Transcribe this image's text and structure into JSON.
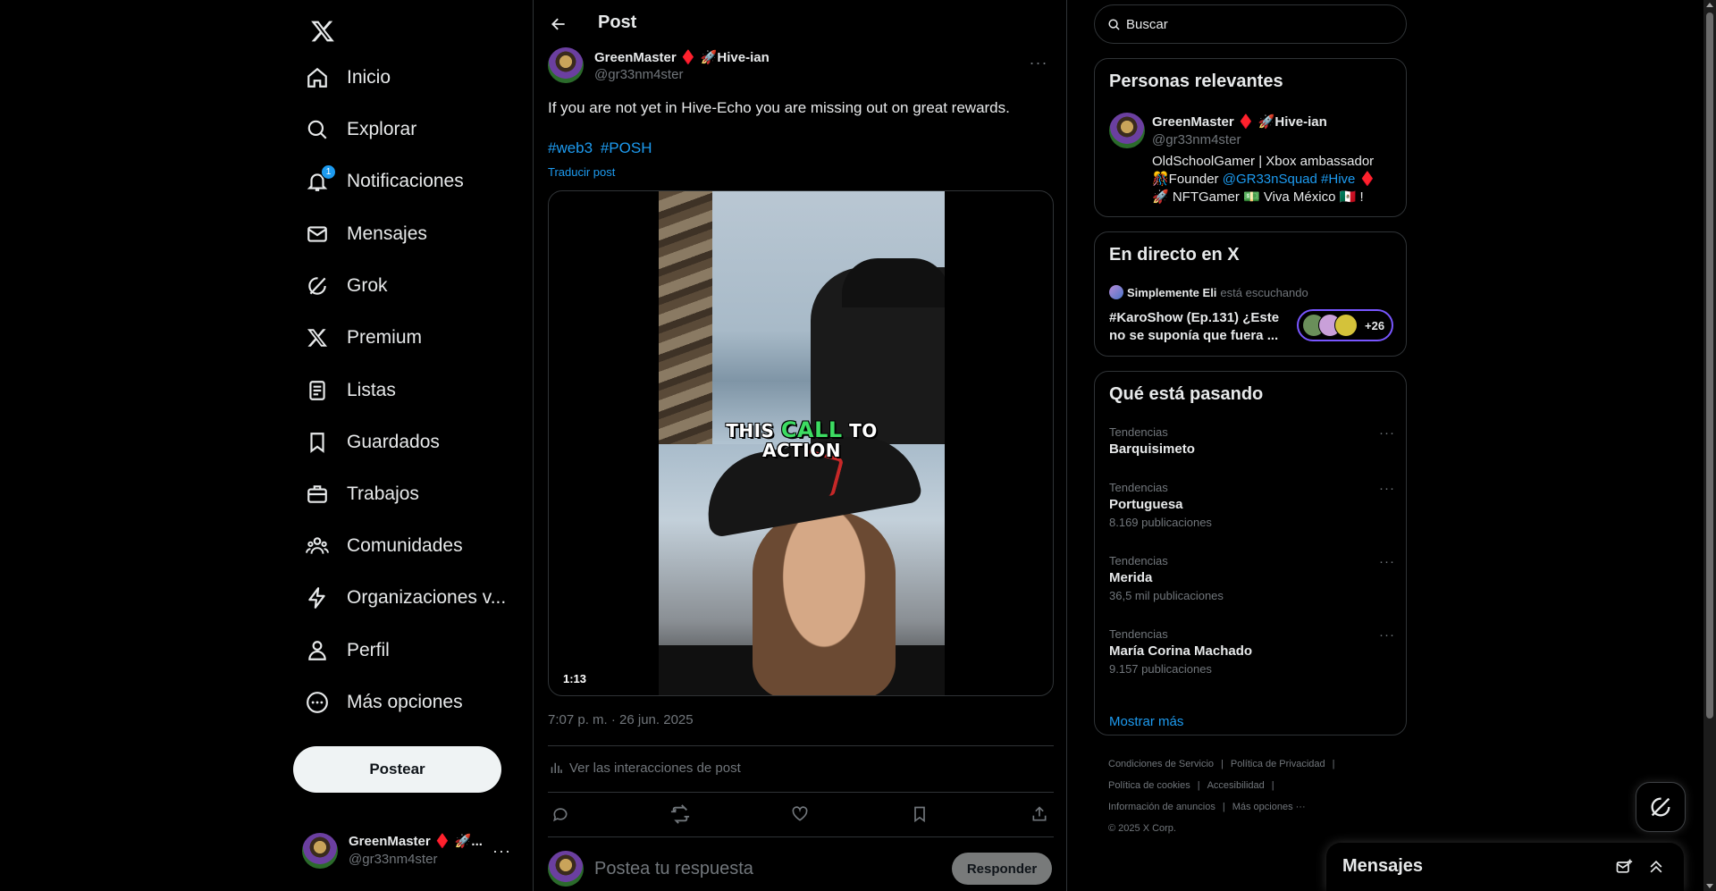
{
  "nav": {
    "items": [
      {
        "label": "Inicio",
        "icon": "home-icon"
      },
      {
        "label": "Explorar",
        "icon": "search-icon"
      },
      {
        "label": "Notificaciones",
        "icon": "bell-icon",
        "badge": "1"
      },
      {
        "label": "Mensajes",
        "icon": "mail-icon"
      },
      {
        "label": "Grok",
        "icon": "grok-icon"
      },
      {
        "label": "Premium",
        "icon": "x-logo-icon"
      },
      {
        "label": "Listas",
        "icon": "list-icon"
      },
      {
        "label": "Guardados",
        "icon": "bookmark-icon"
      },
      {
        "label": "Trabajos",
        "icon": "briefcase-icon"
      },
      {
        "label": "Comunidades",
        "icon": "people-icon"
      },
      {
        "label": "Organizaciones v...",
        "icon": "lightning-icon"
      },
      {
        "label": "Perfil",
        "icon": "person-icon"
      },
      {
        "label": "Más opciones",
        "icon": "more-circle-icon"
      }
    ],
    "post_button": "Postear",
    "account": {
      "name": "GreenMaster ♦️ 🚀...",
      "handle": "@gr33nm4ster",
      "more": "···"
    }
  },
  "header": {
    "title": "Post"
  },
  "post": {
    "author_name": "GreenMaster ♦️ 🚀Hive-ian",
    "author_handle": "@gr33nm4ster",
    "text": "If you are not yet in Hive-Echo you are missing out on great rewards.",
    "hashtags": [
      "#web3",
      "#POSH"
    ],
    "translate": "Traducir post",
    "video": {
      "caption_word1": "THIS",
      "caption_highlight": "CALL",
      "caption_word2": "TO",
      "caption_line2": "ACTION",
      "duration": "1:13"
    },
    "timestamp": "7:07 p. m. · 26 jun. 2025",
    "analytics": "Ver las interacciones de post",
    "actions": [
      "reply-icon",
      "retweet-icon",
      "like-icon",
      "bookmark-icon",
      "share-icon"
    ],
    "reply_placeholder": "Postea tu respuesta",
    "reply_button": "Responder"
  },
  "sidebar": {
    "search_placeholder": "Buscar",
    "relevant": {
      "title": "Personas relevantes",
      "name": "GreenMaster ♦️ 🚀Hive-ian",
      "handle": "@gr33nm4ster",
      "bio_1": "OldSchoolGamer | Xbox ambassador 🎊Founder ",
      "bio_link1": "@GR33nSquad",
      "bio_sp": " ",
      "bio_link2": "#Hive",
      "bio_2": " ♦️ 🚀 NFTGamer 💵 Viva México 🇲🇽 !"
    },
    "live": {
      "title": "En directo en X",
      "host": "Simplemente Eli",
      "status": "está escuchando",
      "space_title": "#KaroShow (Ep.131) ¿Este no se suponía que fuera ...",
      "listeners": "+26"
    },
    "trends": {
      "title": "Qué está pasando",
      "items": [
        {
          "category": "Tendencias",
          "name": "Barquisimeto",
          "posts": ""
        },
        {
          "category": "Tendencias",
          "name": "Portuguesa",
          "posts": "8.169 publicaciones"
        },
        {
          "category": "Tendencias",
          "name": "Merida",
          "posts": "36,5 mil publicaciones"
        },
        {
          "category": "Tendencias",
          "name": "María Corina Machado",
          "posts": "9.157 publicaciones"
        }
      ],
      "show_more": "Mostrar más"
    },
    "footer": {
      "links": [
        "Condiciones de Servicio",
        "|",
        "Política de Privacidad",
        "|",
        "Política de cookies",
        "|",
        "Accesibilidad",
        "|",
        "Información de anuncios",
        "|",
        "Más opciones ···"
      ],
      "copyright": "© 2025 X Corp."
    }
  },
  "messages_drawer": {
    "title": "Mensajes"
  },
  "colors": {
    "accent": "#1d9bf0",
    "background": "#000000",
    "border": "#2f3336",
    "muted": "#71767b",
    "text": "#e7e9ea"
  }
}
